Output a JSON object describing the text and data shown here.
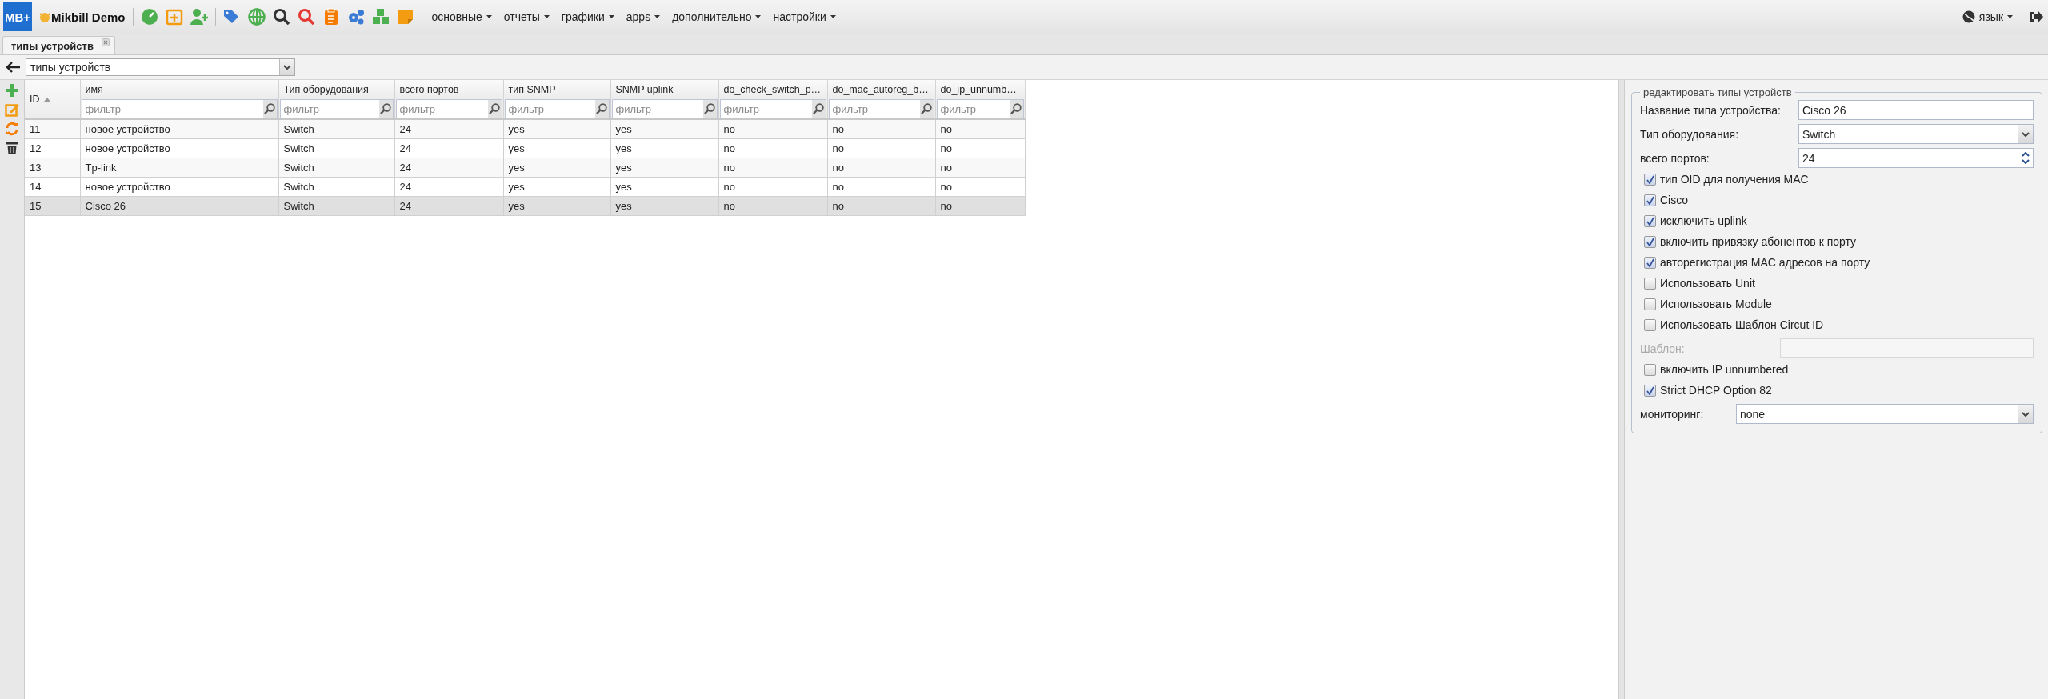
{
  "header": {
    "logo": "MB+",
    "brand": "Mikbill Demo",
    "menus": [
      {
        "label": "основные"
      },
      {
        "label": "отчеты"
      },
      {
        "label": "графики"
      },
      {
        "label": "apps"
      },
      {
        "label": "дополнительно"
      },
      {
        "label": "настройки"
      }
    ],
    "language": "язык"
  },
  "tabs": [
    {
      "label": "типы устройств",
      "selected": true
    }
  ],
  "breadcrumb": {
    "value": "типы устройств"
  },
  "table": {
    "columns": [
      {
        "label": "ID",
        "sorted": true
      },
      {
        "label": "имя",
        "placeholder": "фильтр"
      },
      {
        "label": "Тип оборудования",
        "placeholder": "фильтр"
      },
      {
        "label": "всего портов",
        "placeholder": "фильтр"
      },
      {
        "label": "тип SNMP",
        "placeholder": "фильтр"
      },
      {
        "label": "SNMP uplink",
        "placeholder": "фильтр"
      },
      {
        "label": "do_check_switch_p…",
        "placeholder": "фильтр"
      },
      {
        "label": "do_mac_autoreg_b…",
        "placeholder": "фильтр"
      },
      {
        "label": "do_ip_unnumb…",
        "placeholder": "фильтр"
      }
    ],
    "rows": [
      {
        "selected": false,
        "cells": [
          "11",
          "новое устройство",
          "Switch",
          "24",
          "yes",
          "yes",
          "no",
          "no",
          "no"
        ]
      },
      {
        "selected": false,
        "cells": [
          "12",
          "новое устройство",
          "Switch",
          "24",
          "yes",
          "yes",
          "no",
          "no",
          "no"
        ]
      },
      {
        "selected": false,
        "cells": [
          "13",
          "Tp-link",
          "Switch",
          "24",
          "yes",
          "yes",
          "no",
          "no",
          "no"
        ]
      },
      {
        "selected": false,
        "cells": [
          "14",
          "новое устройство",
          "Switch",
          "24",
          "yes",
          "yes",
          "no",
          "no",
          "no"
        ]
      },
      {
        "selected": true,
        "cells": [
          "15",
          "Cisco 26",
          "Switch",
          "24",
          "yes",
          "yes",
          "no",
          "no",
          "no"
        ]
      }
    ]
  },
  "form": {
    "title": "редактировать типы устройств",
    "fields": [
      {
        "kind": "text",
        "label": "Название типа устройства:",
        "value": "Cisco 26"
      },
      {
        "kind": "select",
        "label": "Тип оборудования:",
        "value": "Switch"
      },
      {
        "kind": "number",
        "label": "всего портов:",
        "value": "24"
      },
      {
        "kind": "checkbox",
        "label": "тип OID для получения MAC",
        "checked": true
      },
      {
        "kind": "checkbox",
        "label": "Cisco",
        "checked": true
      },
      {
        "kind": "checkbox",
        "label": "исключить uplink",
        "checked": true
      },
      {
        "kind": "checkbox",
        "label": "включить привязку абонентов к порту",
        "checked": true
      },
      {
        "kind": "checkbox",
        "label": "авторегистрация MAC адресов на порту",
        "checked": true
      },
      {
        "kind": "checkbox",
        "label": "Использовать Unit",
        "checked": false
      },
      {
        "kind": "checkbox",
        "label": "Использовать Module",
        "checked": false
      },
      {
        "kind": "checkbox",
        "label": "Использовать Шаблон Circut ID",
        "checked": false
      },
      {
        "kind": "text",
        "label": "Шаблон:",
        "disabled": true
      },
      {
        "kind": "checkbox",
        "label": "включить IP unnumbered",
        "checked": false
      },
      {
        "kind": "checkbox",
        "label": "Strict DHCP Option 82",
        "checked": true
      },
      {
        "kind": "select",
        "label": "мониторинг:",
        "value": "none",
        "narrow": true
      }
    ]
  }
}
